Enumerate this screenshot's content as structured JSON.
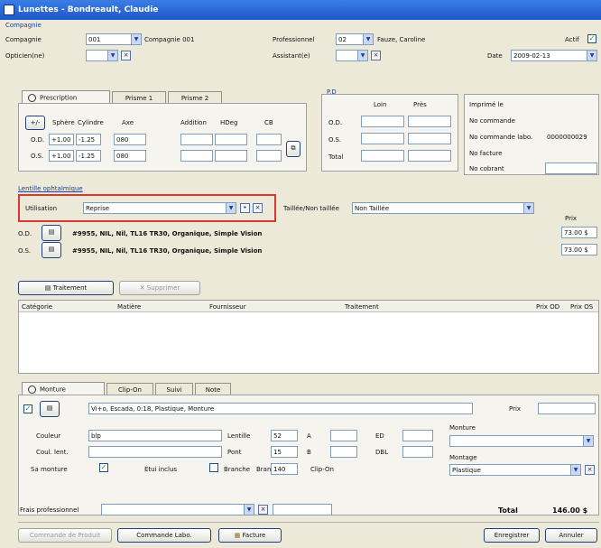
{
  "window": {
    "title": "Lunettes - Bondreault, Claudie"
  },
  "top": {
    "section_label": "Compagnie",
    "compagnie_label": "Compagnie",
    "compagnie_value": "001",
    "compagnie_desc": "Compagnie 001",
    "opticien_label": "Opticien(ne)",
    "professionnel_label": "Professionnel",
    "professionnel_value": "02",
    "professionnel_name": "Fauze, Caroline",
    "assistant_label": "Assistant(e)",
    "actif_label": "Actif",
    "date_label": "Date",
    "date_value": "2009-02-13"
  },
  "rx": {
    "tabs": [
      "Prescription",
      "Prisme 1",
      "Prisme 2"
    ],
    "headers": {
      "pm": "+/-",
      "sphere": "Sphère",
      "cylindre": "Cylindre",
      "axe": "Axe",
      "addition": "Addition",
      "hdeg": "HDeg",
      "cb": "CB"
    },
    "od_label": "O.D.",
    "os_label": "O.S.",
    "od": {
      "sphere": "+1.00",
      "cylindre": "-1.25",
      "axe": "080"
    },
    "os": {
      "sphere": "+1.00",
      "cylindre": "-1.25",
      "axe": "080"
    }
  },
  "pd": {
    "title": "P.D",
    "loin": "Loin",
    "pres": "Près",
    "od": "O.D.",
    "os": "O.S.",
    "total": "Total"
  },
  "info": {
    "imprime": "Imprimé le",
    "no_commande": "No commande",
    "no_commande_labo": "No commande labo.",
    "no_commande_labo_value": "0000000029",
    "no_facture": "No facture",
    "no_cobrant": "No cobrant"
  },
  "lens": {
    "section_label": "Lentille ophtalmique",
    "utilisation_label": "Utilisation",
    "utilisation_value": "Reprise",
    "taillee_label": "Taillée/Non taillée",
    "taillee_value": "Non Taillée",
    "prix_label": "Prix",
    "od_label": "O.D.",
    "od_desc": "#9955, NIL, Nil, TL16 TR30, Organique, Simple Vision",
    "od_price": "73.00 $",
    "os_label": "O.S.",
    "os_desc": "#9955, NIL, Nil, TL16 TR30, Organique, Simple Vision",
    "os_price": "73.00 $"
  },
  "treatment": {
    "btn_traitement": "Traitement",
    "btn_supprimer": "Supprimer",
    "columns": [
      "Catégorie",
      "Matière",
      "Fournisseur",
      "Traitement",
      "Prix OD",
      "Prix OS"
    ]
  },
  "frame": {
    "tabs": [
      "Monture",
      "Clip-On",
      "Suivi",
      "Note"
    ],
    "desc": "Vi+o, Escada, 0:18, Plastique, Monture",
    "prix_label": "Prix",
    "couleur_label": "Couleur",
    "couleur_value": "blp",
    "coul_lent_label": "Coul. lent.",
    "sa_monture_label": "Sa monture",
    "etui_label": "Étui inclus",
    "branche_label": "Branche",
    "lentille_label": "Lentille",
    "lentille_value": "52",
    "pont_label": "Pont",
    "pont_value": "15",
    "branche_field_label": "Branche",
    "branche_value": "140",
    "a_label": "A",
    "b_label": "B",
    "ed_label": "ED",
    "dbl_label": "DBL",
    "clipon_label": "Clip-On",
    "monture_label": "Monture",
    "montage_label": "Montage",
    "montage_value": "Plastique"
  },
  "bottom": {
    "frais_label": "Frais professionnel",
    "total_label": "Total",
    "total_value": "146.00 $",
    "btn_commande_produit": "Commande de Produit",
    "btn_commande_labo": "Commande Labo.",
    "btn_facture": "Facture",
    "btn_enregistrer": "Enregistrer",
    "btn_annuler": "Annuler"
  },
  "colors": {
    "title_bg": "#1d56c9",
    "highlight_border": "#d9382f",
    "yellow_field": "#ffffe0"
  }
}
